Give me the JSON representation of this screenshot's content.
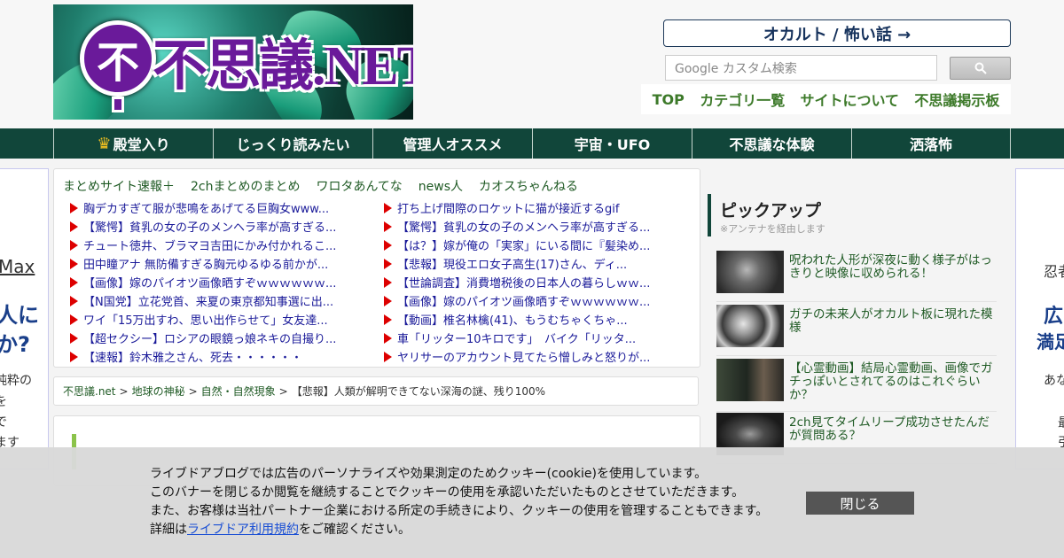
{
  "header": {
    "logo_text": "不思議.NET",
    "logo_glyph": "不",
    "occult_button": "オカルト / 怖い話 →",
    "search_placeholder": "Google カスタム検索",
    "search_icon": "search-icon",
    "top_nav": [
      "TOP",
      "カテゴリ一覧",
      "サイトについて",
      "不思議掲示板"
    ]
  },
  "main_nav": [
    {
      "label": "殿堂入り",
      "icon": "crown-icon"
    },
    {
      "label": "じっくり読みたい"
    },
    {
      "label": "管理人オススメ"
    },
    {
      "label": "宇宙・UFO"
    },
    {
      "label": "不思議な体験"
    },
    {
      "label": "洒落怖"
    }
  ],
  "antenna": {
    "sites": [
      "まとめサイト速報＋",
      "2chまとめのまとめ",
      "ワロタあんてな",
      "news人",
      "カオスちゃんねる"
    ],
    "left": [
      "胸デカすぎて服が悲鳴をあげてる巨胸女www...",
      "【驚愕】貧乳の女の子のメンヘラ率が高すぎる...",
      "チュート徳井、ブラマヨ吉田にかみ付かれるこ...",
      "田中瞳アナ 無防備すぎる胸元ゆるゆる前かが...",
      "【画像】嫁のパイオツ画像晒すぞｗｗｗｗｗｗ...",
      "【N国党】立花党首、来夏の東京都知事選に出...",
      "ワイ「15万出すわ、思い出作らせて」女友達...",
      "【超セクシー】ロシアの眼鏡っ娘ネキの自撮り...",
      "【速報】鈴木雅之さん、死去・・・・・・"
    ],
    "right": [
      "打ち上げ間際のロケットに猫が接近するgif",
      "【驚愕】貧乳の女の子のメンヘラ率が高すぎる...",
      "【は？】嫁が俺の「実家」にいる間に『髪染め...",
      "【悲報】現役エロ女子高生(17)さん、ディ...",
      "【世論調査】消費増税後の日本人の暮らしｗｗ...",
      "【画像】嫁のパイオツ画像晒すぞｗｗｗｗｗｗ...",
      "【動画】椎名林檎(41)、もうむちゃくちゃ...",
      "車「リッター10キロです」　バイク「リッタ...",
      "ヤリサーのアカウント見てたら憎しみと怒りが..."
    ]
  },
  "breadcrumb": {
    "items": [
      "不思議.net",
      "地球の神秘",
      "自然・自然現象"
    ],
    "separator": ">",
    "current": "【悲報】人類が解明できてない深海の謎、残り100%"
  },
  "pickup": {
    "title": "ピックアップ",
    "subtitle": "※アンテナを経由します",
    "items": [
      "呪われた人形が深夜に動く様子がはっきりと映像に収められる！",
      "ガチの未来人がオカルト板に現れた模様",
      "【心霊動画】結局心霊動画、画像でガチっぽいとされてるのはこれぐらいか？",
      "2ch見てタイムリープ成功させたんだが質問ある？"
    ]
  },
  "ads": {
    "left": [
      "Max",
      "人に",
      "か?",
      "純粋の",
      "を",
      "で",
      "ます"
    ],
    "right": [
      "忍者",
      "広",
      "満足",
      "あな",
      "最",
      "引"
    ]
  },
  "cookie": {
    "line1": "ライブドアブログでは広告のパーソナライズや効果測定のためクッキー(cookie)を使用しています。",
    "line2": "このバナーを閉じるか閲覧を継続することでクッキーの使用を承認いただいたものとさせていただきます。",
    "line3": "また、お客様は当社パートナー企業における所定の手続きにより、クッキーの使用を管理することもできます。",
    "line4_prefix": "詳細は",
    "line4_link": "ライブドア利用規約",
    "line4_suffix": "をご確認ください。",
    "close": "閉じる"
  },
  "colors": {
    "nav_bg": "#11463a",
    "link_green": "#1f5a24",
    "link_blue": "#1a1a99",
    "triangle": "#dd0000"
  }
}
